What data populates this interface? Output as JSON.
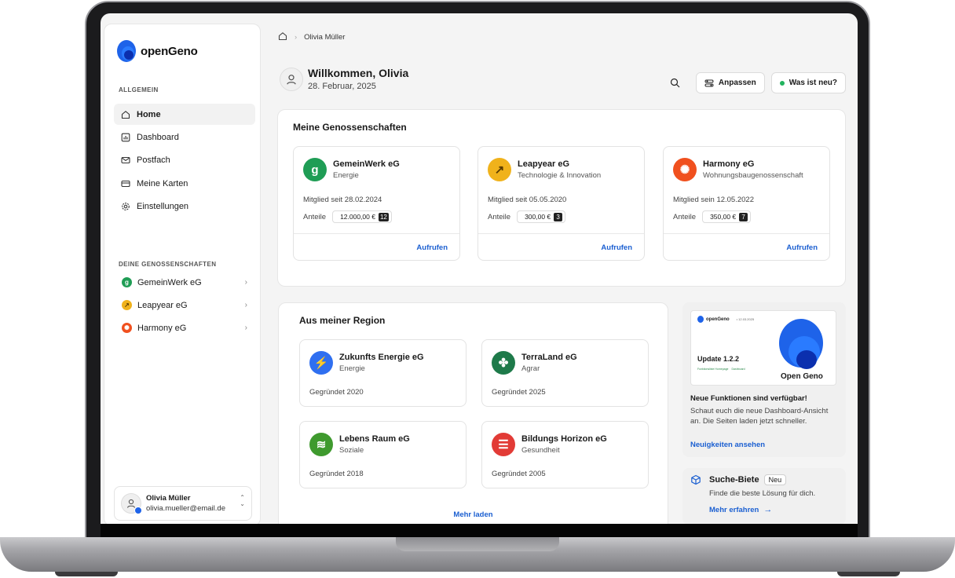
{
  "app": {
    "brand": "openGeno",
    "colors": {
      "accent": "#1b5fd1",
      "brand": "#1e63e9",
      "online": "#22b35e"
    }
  },
  "sidebar": {
    "section_general": "ALLGEMEIN",
    "items": [
      {
        "label": "Home",
        "icon": "home-icon"
      },
      {
        "label": "Dashboard",
        "icon": "chart-icon"
      },
      {
        "label": "Postfach",
        "icon": "mail-icon"
      },
      {
        "label": "Meine Karten",
        "icon": "card-icon"
      },
      {
        "label": "Einstellungen",
        "icon": "gear-icon"
      }
    ],
    "section_coops": "DEINE GENOSSENSCHAFTEN",
    "coops": [
      {
        "label": "GemeinWerk eG",
        "color": "#1f9d55"
      },
      {
        "label": "Leapyear eG",
        "color": "#f0b21b"
      },
      {
        "label": "Harmony eG",
        "color": "#f0501e"
      }
    ],
    "user": {
      "name": "Olivia Müller",
      "email": "olivia.mueller@email.de"
    }
  },
  "header": {
    "breadcrumb": "Olivia Müller",
    "welcome": "Willkommen, Olivia",
    "date": "28. Februar, 2025",
    "customize_label": "Anpassen",
    "whats_new_label": "Was ist neu?"
  },
  "my_coops": {
    "title": "Meine Genossenschaften",
    "shares_label": "Anteile",
    "link_label": "Aufrufen",
    "cards": [
      {
        "name": "GemeinWerk eG",
        "category": "Energie",
        "since": "Mitglied seit 28.02.2024",
        "amount": "12.000,00 €",
        "count": "12",
        "color": "#1f9d55"
      },
      {
        "name": "Leapyear eG",
        "category": "Technologie & Innovation",
        "since": "Mitglied seit 05.05.2020",
        "amount": "300,00 €",
        "count": "3",
        "color": "#f0b21b"
      },
      {
        "name": "Harmony eG",
        "category": "Wohnungsbaugenossenschaft",
        "since": "Mitglied sein 12.05.2022",
        "amount": "350,00 €",
        "count": "7",
        "color": "#f0501e"
      }
    ]
  },
  "region": {
    "title": "Aus meiner Region",
    "more_label": "Mehr laden",
    "cards": [
      {
        "name": "Zukunfts Energie eG",
        "category": "Energie",
        "founded": "Gegründet 2020",
        "color": "#2f6ff0"
      },
      {
        "name": "TerraLand eG",
        "category": "Agrar",
        "founded": "Gegründet 2025",
        "color": "#1e7a4a"
      },
      {
        "name": "Lebens Raum eG",
        "category": "Soziale",
        "founded": "Gegründet 2018",
        "color": "#3f9a2e"
      },
      {
        "name": "Bildungs Horizon eG",
        "category": "Gesundheit",
        "founded": "Gegründet 2005",
        "color": "#e23b36"
      }
    ]
  },
  "promo": {
    "image_brand": "openGeno",
    "image_date": "• 12.03.2025",
    "image_version": "Update 1.2.2",
    "image_tag1": "Funktionsliste Homepage",
    "image_tag2": "Dashboard",
    "image_caption": "Open Geno",
    "title": "Neue Funktionen sind verfügbar!",
    "text": "Schaut euch die neue Dashboard-Ansicht an. Die Seiten laden jetzt schneller.",
    "link": "Neuigkeiten ansehen"
  },
  "search_offer": {
    "title": "Suche-Biete",
    "badge": "Neu",
    "text": "Finde die beste Lösung für dich.",
    "link": "Mehr erfahren"
  }
}
